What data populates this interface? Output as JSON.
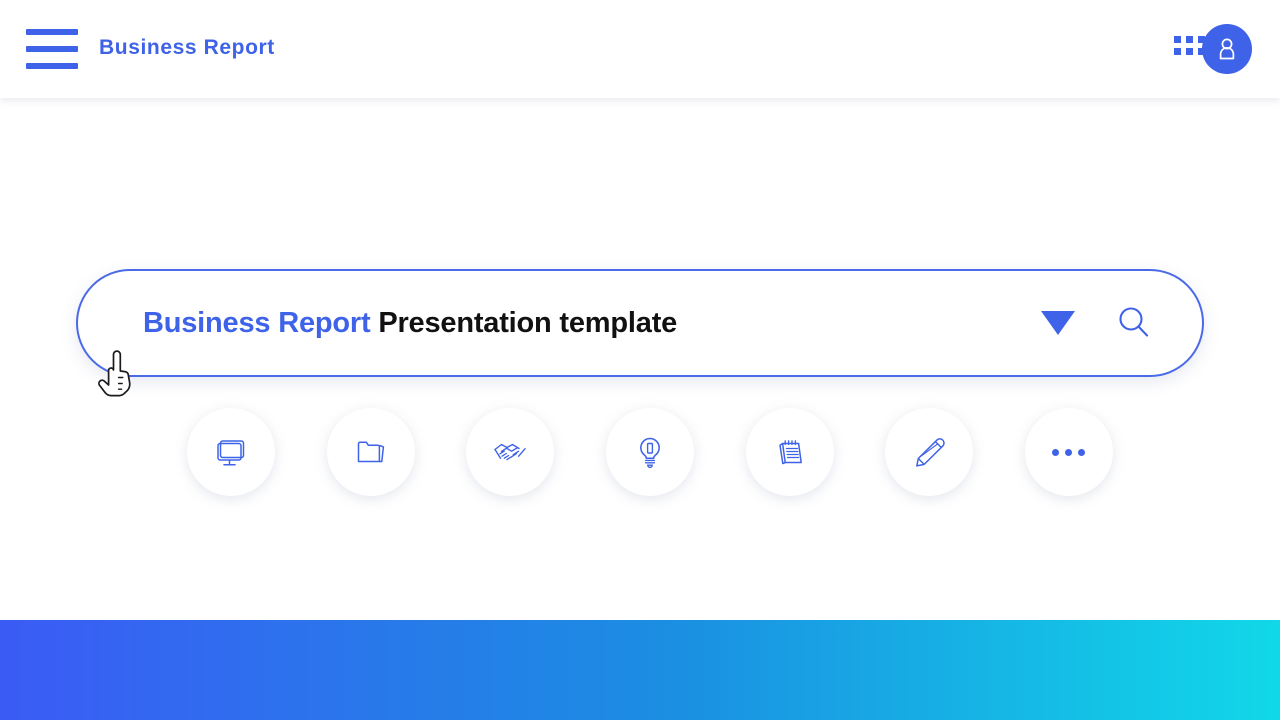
{
  "header": {
    "menu_label": "menu",
    "title": "Business Report",
    "apps_label": "apps",
    "account_label": "account"
  },
  "search": {
    "accent_text": "Business Report",
    "plain_text": "Presentation template",
    "dropdown_label": "open filter dropdown",
    "search_label": "search"
  },
  "cursor": {
    "label": "pointing hand cursor"
  },
  "quick_actions": {
    "items": [
      {
        "name": "monitor-icon",
        "label": "monitor"
      },
      {
        "name": "folder-icon",
        "label": "folder"
      },
      {
        "name": "handshake-icon",
        "label": "handshake"
      },
      {
        "name": "lightbulb-icon",
        "label": "lightbulb"
      },
      {
        "name": "notepad-icon",
        "label": "notepad"
      },
      {
        "name": "pencil-icon",
        "label": "pencil"
      },
      {
        "name": "more-icon",
        "label": "more"
      }
    ]
  },
  "footer": {
    "gradient_start": "#3b5bf5",
    "gradient_mid": "#1b8ee2",
    "gradient_end": "#11d8e8"
  },
  "theme": {
    "accent": "#3f63e8",
    "text_dark": "#111111",
    "background": "#ffffff"
  }
}
